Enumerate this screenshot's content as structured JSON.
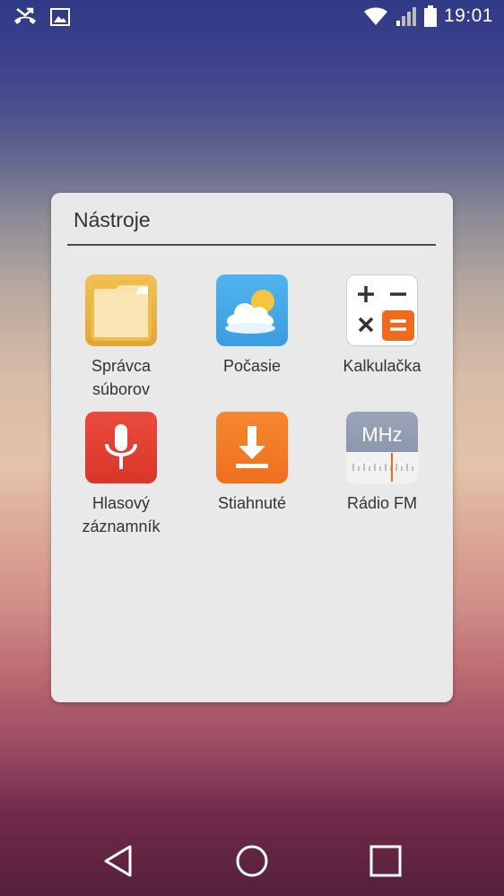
{
  "status_bar": {
    "time": "19:01",
    "left_icons": [
      "missed-call-icon",
      "image-icon"
    ],
    "right_icons": [
      "wifi-icon",
      "signal-icon",
      "battery-icon"
    ]
  },
  "folder": {
    "title": "Nástroje",
    "apps": [
      {
        "name": "file-manager",
        "label_lines": [
          "Správca",
          "súborov"
        ],
        "icon": "folder-icon"
      },
      {
        "name": "weather",
        "label_lines": [
          "Počasie"
        ],
        "icon": "weather-icon"
      },
      {
        "name": "calculator",
        "label_lines": [
          "Kalkulačka"
        ],
        "icon": "calculator-icon"
      },
      {
        "name": "voice-recorder",
        "label_lines": [
          "Hlasový",
          "záznamník"
        ],
        "icon": "microphone-icon"
      },
      {
        "name": "downloads",
        "label_lines": [
          "Stiahnuté"
        ],
        "icon": "download-icon"
      },
      {
        "name": "fm-radio",
        "label_lines": [
          "Rádio FM"
        ],
        "icon": "radio-icon"
      }
    ],
    "radio_icon_text": "MHz"
  },
  "nav_bar": {
    "buttons": [
      "back-icon",
      "home-icon",
      "recents-icon"
    ]
  }
}
